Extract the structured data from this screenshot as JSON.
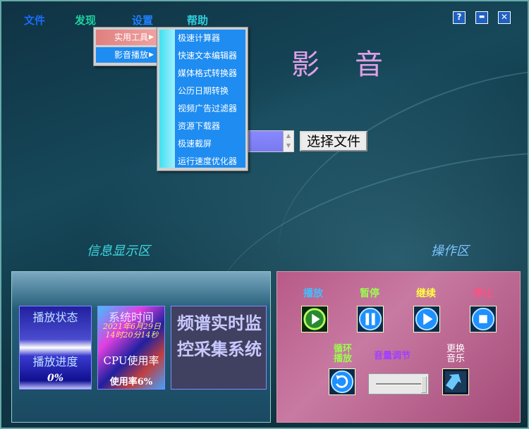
{
  "menu": {
    "file": "文件",
    "discover": "发现",
    "settings": "设置",
    "help": "帮助"
  },
  "window_controls": {
    "help": "?",
    "minimize": "▬",
    "close": "✕"
  },
  "title_chars": [
    "影",
    "音"
  ],
  "submenu_discover": [
    {
      "label": "实用工具",
      "arrow": "▶"
    },
    {
      "label": "影音播放",
      "arrow": "▶"
    }
  ],
  "submenu_tools": [
    "极速计算器",
    "快速文本编辑器",
    "媒体格式转换器",
    "公历日期转换",
    "视频广告过滤器",
    "资源下载器",
    "极速截屏",
    "运行速度优化器"
  ],
  "choose_file_button": "选择文件",
  "info_area_label": "信息显示区",
  "operation_area_label": "操作区",
  "monitor": {
    "play_state_title": "播放状态",
    "play_progress_title": "播放进度",
    "play_progress_value": "0%",
    "system_time_title": "系统时间",
    "system_time_value": "2021年6月29日14时20分14秒",
    "cpu_title": "CPU使用率",
    "cpu_value": "使用率6%",
    "spectrum_title": "频谱实时监控采集系统"
  },
  "controls": {
    "play": "播放",
    "pause": "暂停",
    "resume": "继续",
    "stop": "停止",
    "loop": "循环播放",
    "volume": "音量调节",
    "change_music": "更换音乐"
  },
  "colors": {
    "menu_file": "#1a6cff",
    "menu_discover": "#1fd1a0",
    "menu_settings": "#2080ff",
    "menu_help": "#30d0e0",
    "play": "#40c0ff",
    "pause": "#9aff4a",
    "resume": "#ffff40",
    "stop": "#ff5080",
    "loop": "#9aff4a",
    "volume": "#a040ff",
    "change_music": "#ffffff",
    "info_label": "#40d8e0",
    "operation_label": "#7cc4ff"
  }
}
